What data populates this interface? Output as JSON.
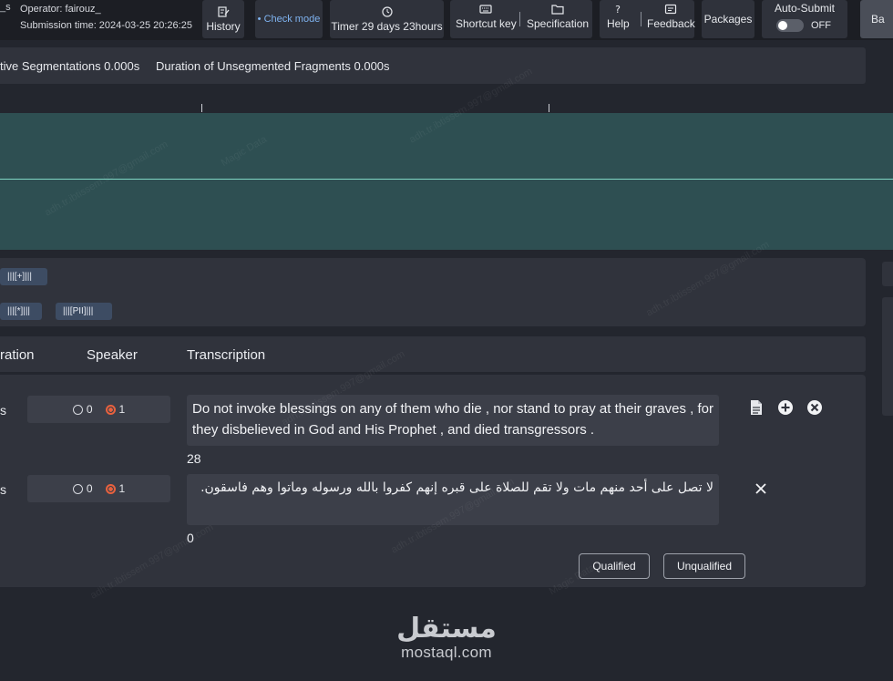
{
  "toolbar": {
    "clipped_prefix": "_s",
    "operator": "Operator: fairouz_",
    "submission_time": "Submission time: 2024-03-25 20:26:25",
    "history": "History",
    "check_mode": "• Check mode",
    "timer": "Timer 29 days 23hours",
    "shortcut_key": "Shortcut key",
    "specification": "Specification",
    "help": "Help",
    "feedback": "Feedback",
    "packages": "Packages",
    "auto_submit_label": "Auto-Submit",
    "auto_submit_state": "OFF",
    "clipped_button": "Ba"
  },
  "stats": {
    "effective_segmentations": "tive Segmentations 0.000s",
    "unsegmented_duration": "Duration of Unsegmented Fragments 0.000s"
  },
  "tags": {
    "row1": [
      "|||[+]|||"
    ],
    "row2": [
      "|||[*]|||",
      "|||[PII]|||"
    ]
  },
  "table": {
    "col_duration": "ration",
    "col_speaker": "Speaker",
    "col_transcription": "Transcription"
  },
  "segments": [
    {
      "duration_cut": "s",
      "speaker_options": [
        "0",
        "1"
      ],
      "speaker_selected": "1",
      "text": "Do not invoke blessings on any of them who die , nor stand to pray at their graves , for they disbelieved in God and His Prophet , and died transgressors .",
      "count": "28"
    },
    {
      "duration_cut": "s",
      "speaker_options": [
        "0",
        "1"
      ],
      "speaker_selected": "1",
      "text": "لا تصل على أحد منهم مات ولا تقم للصلاة على قبره إنهم كفروا بالله ورسوله وماتوا وهم فاسقون.",
      "count": "0"
    }
  ],
  "actions": {
    "qualified": "Qualified",
    "unqualified": "Unqualified"
  },
  "brand": {
    "arabic": "مستقل",
    "latin": "mostaql.com"
  },
  "watermark": {
    "line1": "Magic Data",
    "line2": "adh.tr.ibtissem.997@gmail.com"
  },
  "colors": {
    "background": "#23262e",
    "panel": "#30333c",
    "waveform": "#2e4f52",
    "tag": "#3d4c63",
    "radio_selected": "#e8613e",
    "check_mode": "#7fb3f0"
  }
}
